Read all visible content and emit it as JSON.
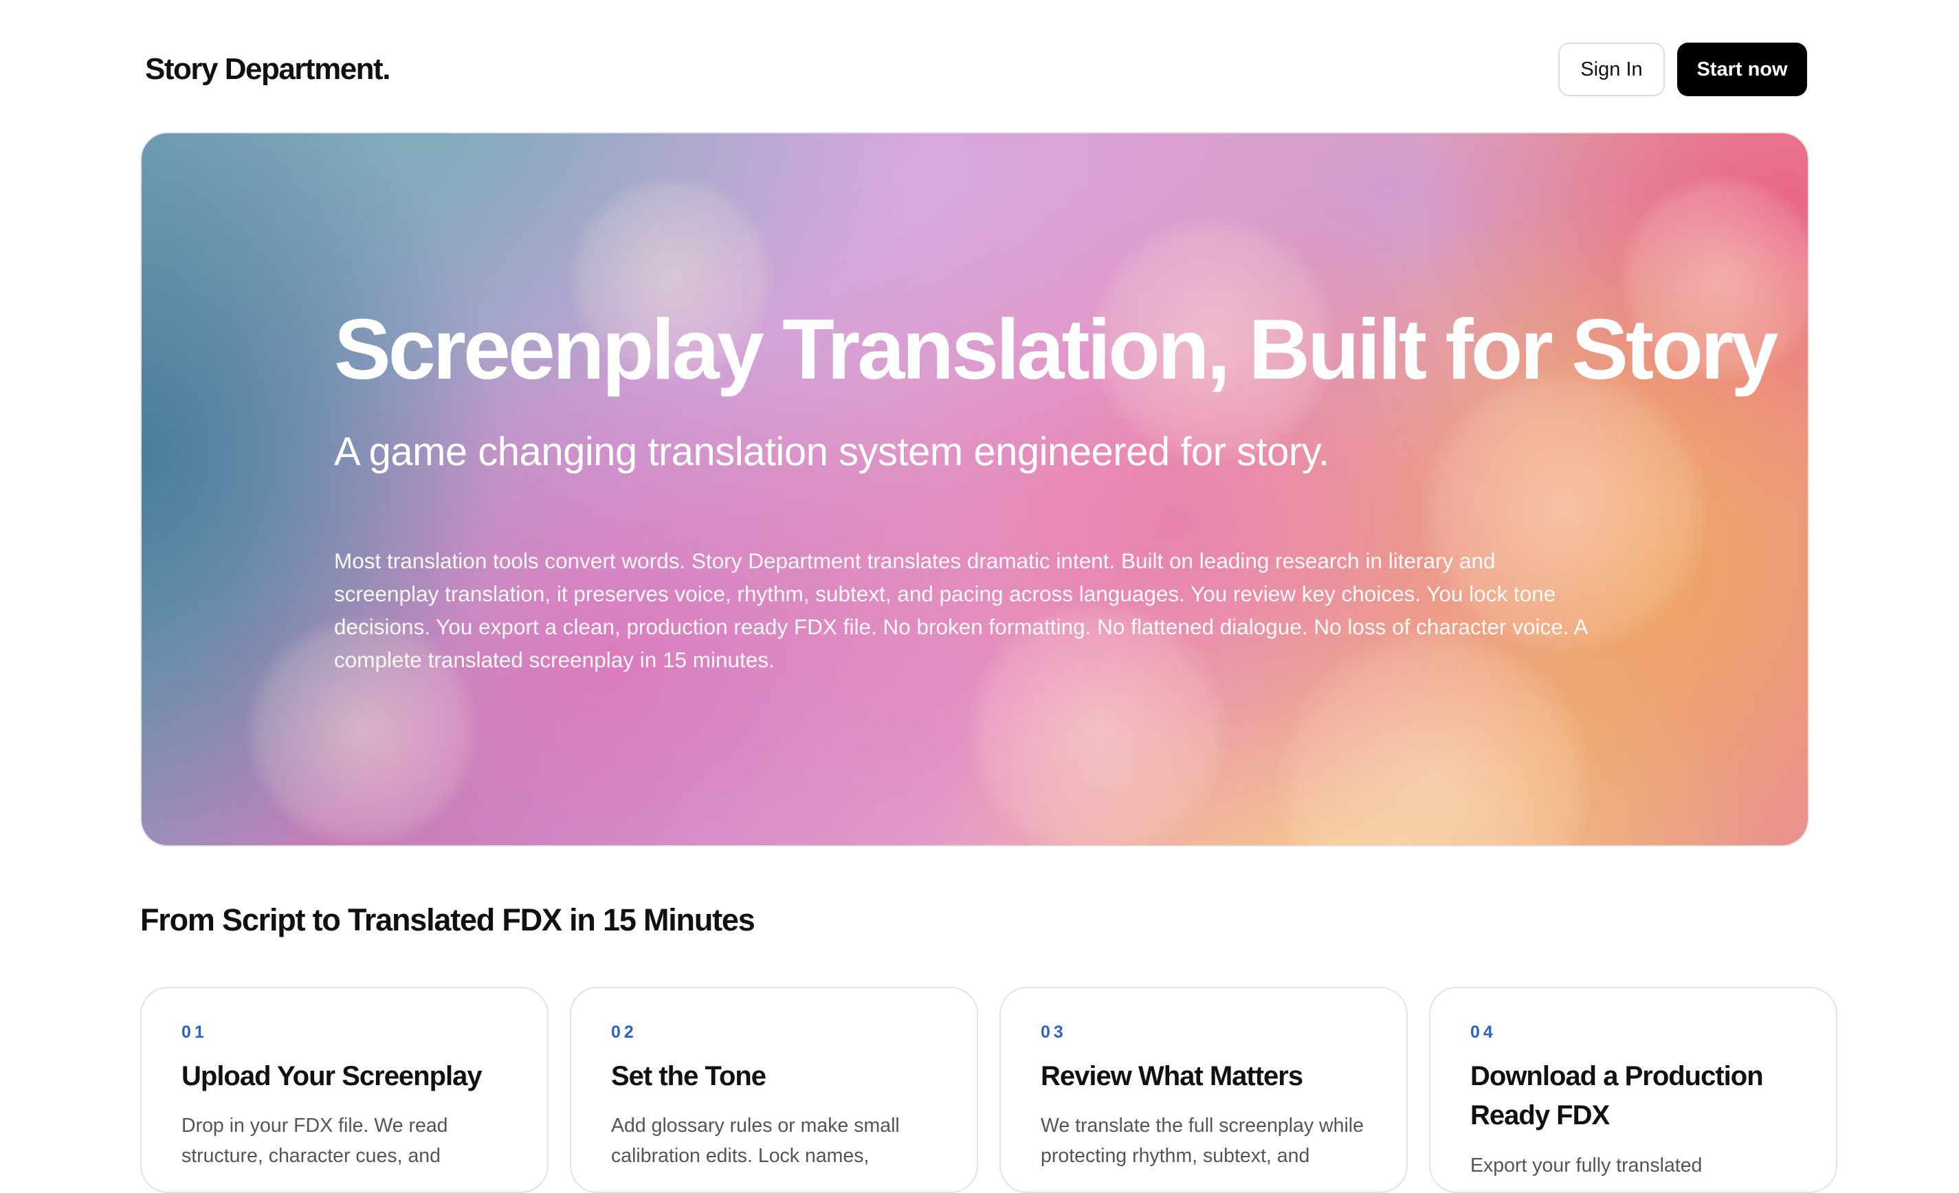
{
  "header": {
    "brand": "Story Department.",
    "sign_in_label": "Sign In",
    "start_label": "Start now"
  },
  "hero": {
    "title": "Screenplay Translation, Built for Story",
    "subtitle": "A game changing translation system engineered for story.",
    "body": "Most translation tools convert words. Story Department translates dramatic intent. Built on leading research in literary and screenplay translation, it preserves voice, rhythm, subtext, and pacing across languages. You review key choices. You lock tone decisions. You export a clean, production ready FDX file. No broken formatting. No flattened dialogue. No loss of character voice. A complete translated screenplay in 15 minutes."
  },
  "steps": {
    "title": "From Script to Translated FDX in 15 Minutes",
    "items": [
      {
        "number": "01",
        "title": "Upload Your Screenplay",
        "description": "Drop in your FDX file. We read structure, character cues, and"
      },
      {
        "number": "02",
        "title": "Set the Tone",
        "description": "Add glossary rules or make small calibration edits. Lock names,"
      },
      {
        "number": "03",
        "title": "Review What Matters",
        "description": "We translate the full screenplay while protecting rhythm, subtext, and"
      },
      {
        "number": "04",
        "title": "Download a Production Ready FDX",
        "description": "Export your fully translated"
      }
    ]
  },
  "colors": {
    "accent": "#2b63c9",
    "primary_button": "#000000",
    "text": "#111111",
    "muted_text": "#555555"
  }
}
